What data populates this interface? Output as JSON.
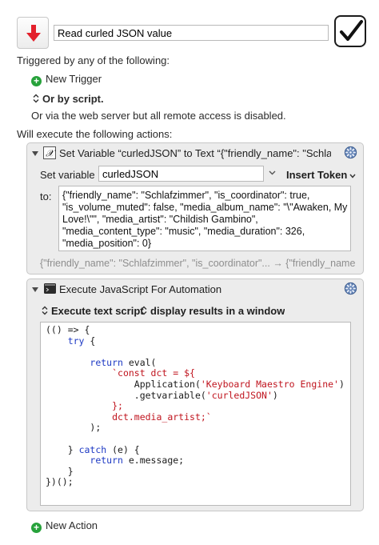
{
  "macro": {
    "name": "Read curled JSON value",
    "icon": "red-down-arrow-icon",
    "enabled": true
  },
  "triggers": {
    "heading": "Triggered by any of the following:",
    "new_trigger": "New Trigger",
    "or_by_script": "Or by script.",
    "web_server_note": "Or via the web server but all remote access is disabled."
  },
  "actions_heading": "Will execute the following actions:",
  "set_variable_action": {
    "title": "Set Variable “curledJSON” to Text “{\"friendly_name\": \"Schlafzimmer\", \"is_coordinator\": true,",
    "set_variable_label": "Set variable",
    "variable_name": "curledJSON",
    "insert_token_label": "Insert Token",
    "to_label": "to:",
    "text_lines": [
      "{\"friendly_name\": \"Schlafzimmer\", \"is_coordinator\": true,",
      "\"is_volume_muted\": false, \"media_album_name\": \"\\\"Awaken, My",
      "Love!\\\"\", \"media_artist\": \"Childish Gambino\",",
      "\"media_content_type\": \"music\", \"media_duration\": 326,",
      "\"media_position\": 0}"
    ],
    "preview": "{\"friendly_name\": \"Schlafzimmer\", \"is_coordinator\"... → {\"friendly_name\": \"Schlafzimmer\""
  },
  "jxa_action": {
    "title": "Execute JavaScript For Automation",
    "execute_option": "Execute text script",
    "result_option": "display results in a window",
    "code": {
      "l1": "(() => {",
      "try_kw": "try",
      "brace_open": " {",
      "return_kw": "return",
      "eval_open": " eval(",
      "tpl_open": "`const dct = ${",
      "app_call": "Application(",
      "app_arg": "'Keyboard Maestro Engine'",
      "close_paren": ")",
      "getvar_call": ".getvariable(",
      "getvar_arg": "'curledJSON'",
      "getvar_close": ")",
      "tpl_close": "};",
      "tpl_last": "dct.media_artist;`",
      "eval_close": ");",
      "catch_pre": "} ",
      "catch_kw": "catch",
      "catch_post": " (e) {",
      "return_msg": " e.message;",
      "brace_close": "}",
      "iife_close": "})();"
    }
  },
  "new_action": "New Action",
  "colors": {
    "accent_green": "#27a23b",
    "arrow_red": "#e3202b",
    "keyword_blue": "#1d39c4",
    "string_red": "#c0141e"
  }
}
